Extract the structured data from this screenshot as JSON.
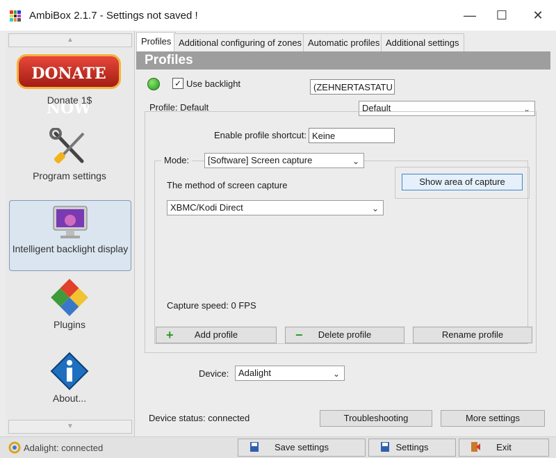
{
  "window": {
    "title": "AmbiBox 2.1.7  - Settings not saved !",
    "controls": {
      "minimize": "—",
      "maximize": "☐",
      "close": "✕"
    }
  },
  "sidebar": {
    "scroll_up": "▲",
    "scroll_down": "▼",
    "donate_button": "DONATE NOW",
    "items": [
      {
        "label": "Donate 1$",
        "icon": "donate-icon"
      },
      {
        "label": "Program settings",
        "icon": "tools-icon"
      },
      {
        "label": "Intelligent backlight display",
        "icon": "monitor-icon",
        "selected": true
      },
      {
        "label": "Plugins",
        "icon": "puzzle-icon"
      },
      {
        "label": "About...",
        "icon": "info-icon"
      }
    ]
  },
  "tabs": [
    {
      "label": "Profiles",
      "active": true
    },
    {
      "label": "Additional configuring of zones"
    },
    {
      "label": "Automatic profiles"
    },
    {
      "label": "Additional settings"
    }
  ],
  "profiles": {
    "header": "Profiles",
    "use_backlight": {
      "label": "Use backlight",
      "checked": true,
      "check_mark": "✓"
    },
    "hotkey_field": "(ZEHNERTASTATU",
    "profile_label": "Profile: Default",
    "profile_select": "Default",
    "shortcut_label": "Enable profile shortcut:",
    "shortcut_value": "Keine",
    "mode_label": "Mode:",
    "mode_select": "[Software] Screen capture",
    "capture_method_label": "The method of screen capture",
    "capture_method_select": "XBMC/Kodi Direct",
    "show_area_button": "Show area of capture",
    "capture_speed": "Capture speed: 0 FPS",
    "add_profile": "Add profile",
    "delete_profile": "Delete profile",
    "rename_profile": "Rename profile",
    "device_label": "Device:",
    "device_select": "Adalight",
    "device_status": "Device status: connected",
    "troubleshooting": "Troubleshooting",
    "more_settings": "More settings"
  },
  "statusbar": {
    "status_text": "Adalight: connected",
    "save_settings": "Save settings",
    "settings": "Settings",
    "exit": "Exit"
  },
  "colors": {
    "accent": "#3d86d0",
    "header": "#9e9e9e",
    "led": "#1c9b1a"
  }
}
